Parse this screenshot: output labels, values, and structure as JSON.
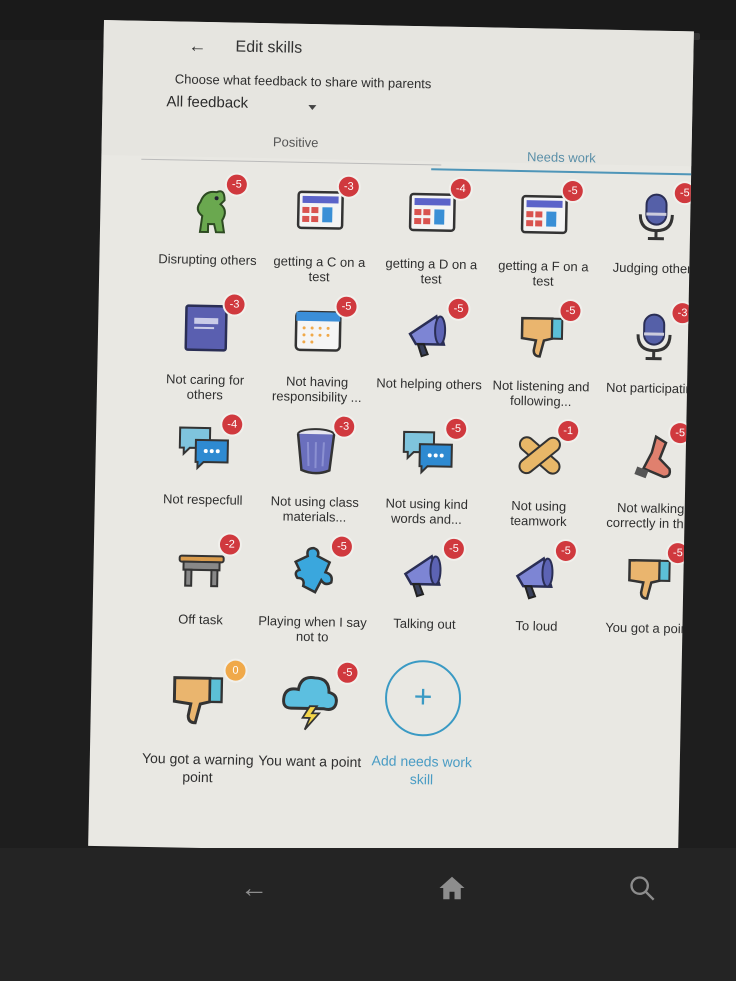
{
  "app": {
    "title": "Edit skills",
    "back_icon": "arrow-left-icon",
    "subtitle": "Choose what feedback to share with parents",
    "feedback_dropdown": {
      "selected": "All feedback"
    }
  },
  "tabs": [
    {
      "label": "Positive",
      "active": false
    },
    {
      "label": "Needs work",
      "active": true
    }
  ],
  "colors": {
    "accent": "#3a9ac4",
    "badge_negative": "#d0393e",
    "badge_zero": "#f0a94a",
    "background": "#e9e8e3"
  },
  "skills": [
    {
      "label": "Disrupting others",
      "points": "-5",
      "icon": "dinosaur-icon"
    },
    {
      "label": "getting a C on a test",
      "points": "-3",
      "icon": "calculator-icon"
    },
    {
      "label": "getting a D on a test",
      "points": "-4",
      "icon": "calculator-icon"
    },
    {
      "label": "getting a F on a test",
      "points": "-5",
      "icon": "calculator-icon"
    },
    {
      "label": "Judging others",
      "points": "-5",
      "icon": "microphone-icon"
    },
    {
      "label": "Not caring for others",
      "points": "-3",
      "icon": "book-icon"
    },
    {
      "label": "Not having responsibility ...",
      "points": "-5",
      "icon": "calendar-icon"
    },
    {
      "label": "Not helping others",
      "points": "-5",
      "icon": "megaphone-icon"
    },
    {
      "label": "Not listening and following...",
      "points": "-5",
      "icon": "thumbs-down-icon"
    },
    {
      "label": "Not participating",
      "points": "-3",
      "icon": "microphone-icon"
    },
    {
      "label": "Not respecfull",
      "points": "-4",
      "icon": "chat-bubbles-icon"
    },
    {
      "label": "Not using class materials...",
      "points": "-3",
      "icon": "trash-can-icon"
    },
    {
      "label": "Not using kind words and...",
      "points": "-5",
      "icon": "chat-bubbles-icon"
    },
    {
      "label": "Not using teamwork",
      "points": "-1",
      "icon": "bandage-icon"
    },
    {
      "label": "Not walking correctly in th...",
      "points": "-5",
      "icon": "shoe-icon"
    },
    {
      "label": "Off task",
      "points": "-2",
      "icon": "desk-icon"
    },
    {
      "label": "Playing when I say not to",
      "points": "-5",
      "icon": "puzzle-piece-icon"
    },
    {
      "label": "Talking out",
      "points": "-5",
      "icon": "megaphone-icon"
    },
    {
      "label": "To loud",
      "points": "-5",
      "icon": "megaphone-icon"
    },
    {
      "label": "You got a point",
      "points": "-5",
      "icon": "thumbs-down-icon"
    },
    {
      "label": "You got a warning point",
      "points": "0",
      "icon": "thumbs-down-icon"
    },
    {
      "label": "You want a point",
      "points": "-5",
      "icon": "storm-cloud-icon"
    }
  ],
  "add_skill": {
    "label": "Add needs work skill",
    "icon": "plus-icon"
  },
  "nav_bar": {
    "back": "back-arrow-icon",
    "home": "home-icon",
    "search": "search-icon"
  }
}
